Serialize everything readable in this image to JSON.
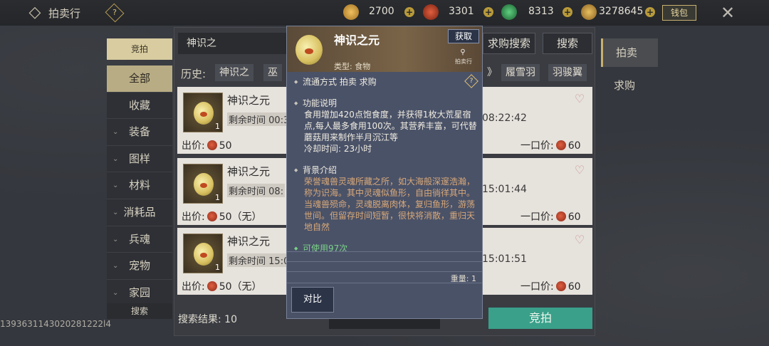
{
  "header": {
    "title": "拍卖行",
    "help": "?",
    "currencies": [
      {
        "value": "2700",
        "color": "#d0a040"
      },
      {
        "value": "3301",
        "color": "#c04a30"
      },
      {
        "value": "8313",
        "color": "#30a060"
      },
      {
        "value": "3278645",
        "color": "#c89830"
      }
    ],
    "wallet": "钱包"
  },
  "left": {
    "tab": "竞拍",
    "categories": [
      "全部",
      "收藏",
      "装备",
      "图样",
      "材料",
      "消耗品",
      "兵魂",
      "宠物",
      "家园"
    ],
    "search": "搜索"
  },
  "main": {
    "search_value": "神识之",
    "buy_request_search": "求购搜索",
    "search": "搜索",
    "history_label": "历史:",
    "history": [
      "神识之",
      "巫",
      "》",
      "履雪羽",
      "羽骏翼"
    ],
    "rows": [
      {
        "name": "神识之元",
        "remain_label": "剩余时间",
        "remain_prefix": "00:3",
        "time": "08:22:42",
        "price_label": "出价:",
        "price": "50",
        "buy_label": "一口价:",
        "buy": "60",
        "qty": "1"
      },
      {
        "name": "神识之元",
        "remain_label": "剩余时间",
        "remain_prefix": "08:",
        "time": "15:01:44",
        "price_label": "出价:",
        "price": "50（无）",
        "buy_label": "一口价:",
        "buy": "60",
        "qty": "1"
      },
      {
        "name": "神识之元",
        "remain_label": "剩余时间",
        "remain_prefix": "15:0",
        "time": "15:01:51",
        "price_label": "出价:",
        "price": "50（无）",
        "buy_label": "一口价:",
        "buy": "60",
        "qty": "1"
      }
    ],
    "results": "搜索结果: 10",
    "bid_button": "竞拍"
  },
  "right_tabs": [
    "拍卖",
    "求购"
  ],
  "tooltip": {
    "name": "神识之元",
    "type": "类型: 食物",
    "get": "获取",
    "auction_label": "拍卖行",
    "circulation": "流通方式   拍卖  求购",
    "func_title": "功能说明",
    "func_text": "食用增加420点饱食度，并获得1枚大荒星宿点,每人最多食用100次。其营养丰富，可代替蘑菇用来制作半月沉江等",
    "cooldown": "冷却时间: 23小时",
    "bg_title": "背景介绍",
    "bg_text": "荣誉魂兽灵魂所藏之所，如大海般深邃浩瀚，称为识海。其中灵魂似鱼形，自由徜徉其中。当魂兽殒命，灵魂脱离肉体，复归鱼形，游荡世间。但留存时间短暂，很快将消散，重归天地自然",
    "uses": "可使用97次",
    "weight": "重量: 1",
    "compare": "对比"
  },
  "footer_id": "1393631143020281222l4"
}
